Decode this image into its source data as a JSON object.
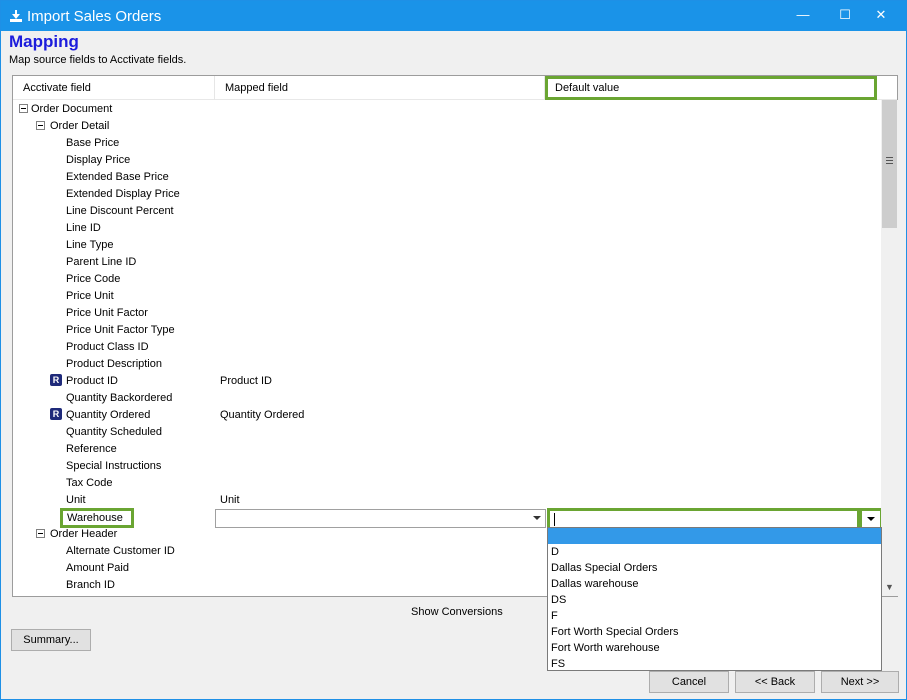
{
  "window": {
    "title": "Import Sales Orders",
    "minimize": "—",
    "maximize": "☐",
    "close": "✕"
  },
  "page": {
    "title": "Mapping",
    "subtitle": "Map source fields to Acctivate fields."
  },
  "grid": {
    "headers": {
      "activate_field": "Acctivate field",
      "mapped_field": "Mapped field",
      "default_value": "Default value"
    },
    "rows": [
      {
        "label": "Order Document",
        "mapped": "",
        "level": 0,
        "toggle": true,
        "required": false
      },
      {
        "label": "Order Detail",
        "mapped": "",
        "level": 1,
        "toggle": true,
        "required": false
      },
      {
        "label": "Base Price",
        "mapped": "",
        "level": 2,
        "toggle": false,
        "required": false
      },
      {
        "label": "Display Price",
        "mapped": "",
        "level": 2,
        "toggle": false,
        "required": false
      },
      {
        "label": "Extended Base Price",
        "mapped": "",
        "level": 2,
        "toggle": false,
        "required": false
      },
      {
        "label": "Extended Display Price",
        "mapped": "",
        "level": 2,
        "toggle": false,
        "required": false
      },
      {
        "label": "Line Discount Percent",
        "mapped": "",
        "level": 2,
        "toggle": false,
        "required": false
      },
      {
        "label": "Line ID",
        "mapped": "",
        "level": 2,
        "toggle": false,
        "required": false
      },
      {
        "label": "Line Type",
        "mapped": "",
        "level": 2,
        "toggle": false,
        "required": false
      },
      {
        "label": "Parent Line ID",
        "mapped": "",
        "level": 2,
        "toggle": false,
        "required": false
      },
      {
        "label": "Price Code",
        "mapped": "",
        "level": 2,
        "toggle": false,
        "required": false
      },
      {
        "label": "Price Unit",
        "mapped": "",
        "level": 2,
        "toggle": false,
        "required": false
      },
      {
        "label": "Price Unit Factor",
        "mapped": "",
        "level": 2,
        "toggle": false,
        "required": false
      },
      {
        "label": "Price Unit Factor Type",
        "mapped": "",
        "level": 2,
        "toggle": false,
        "required": false
      },
      {
        "label": "Product Class ID",
        "mapped": "",
        "level": 2,
        "toggle": false,
        "required": false
      },
      {
        "label": "Product Description",
        "mapped": "",
        "level": 2,
        "toggle": false,
        "required": false
      },
      {
        "label": "Product ID",
        "mapped": "Product ID",
        "level": 2,
        "toggle": false,
        "required": true
      },
      {
        "label": "Quantity Backordered",
        "mapped": "",
        "level": 2,
        "toggle": false,
        "required": false
      },
      {
        "label": "Quantity Ordered",
        "mapped": "Quantity Ordered",
        "level": 2,
        "toggle": false,
        "required": true
      },
      {
        "label": "Quantity Scheduled",
        "mapped": "",
        "level": 2,
        "toggle": false,
        "required": false
      },
      {
        "label": "Reference",
        "mapped": "",
        "level": 2,
        "toggle": false,
        "required": false
      },
      {
        "label": "Special Instructions",
        "mapped": "",
        "level": 2,
        "toggle": false,
        "required": false
      },
      {
        "label": "Tax Code",
        "mapped": "",
        "level": 2,
        "toggle": false,
        "required": false
      },
      {
        "label": "Unit",
        "mapped": "Unit",
        "level": 2,
        "toggle": false,
        "required": false
      }
    ],
    "warehouse_row": {
      "label": "Warehouse",
      "mapped_value": "",
      "default_value": ""
    },
    "rows_after": [
      {
        "label": "Order Header",
        "level": 1,
        "toggle": true
      },
      {
        "label": "Alternate Customer ID",
        "level": 2,
        "toggle": false
      },
      {
        "label": "Amount Paid",
        "level": 2,
        "toggle": false
      },
      {
        "label": "Branch ID",
        "level": 2,
        "toggle": false
      }
    ],
    "required_glyph": "R"
  },
  "dropdown": {
    "options": [
      "",
      "D",
      "Dallas Special Orders",
      "Dallas warehouse",
      "DS",
      "F",
      "Fort Worth Special Orders",
      "Fort Worth warehouse",
      "FS"
    ],
    "selected_index": 0
  },
  "footer": {
    "show_conversions": "Show Conversions",
    "summary": "Summary...",
    "cancel": "Cancel",
    "back": "<< Back",
    "next": "Next >>"
  },
  "colors": {
    "titlebar": "#1a93e8",
    "highlight": "#6aa532",
    "heading": "#1c1cdc",
    "selection": "#3399e8"
  }
}
